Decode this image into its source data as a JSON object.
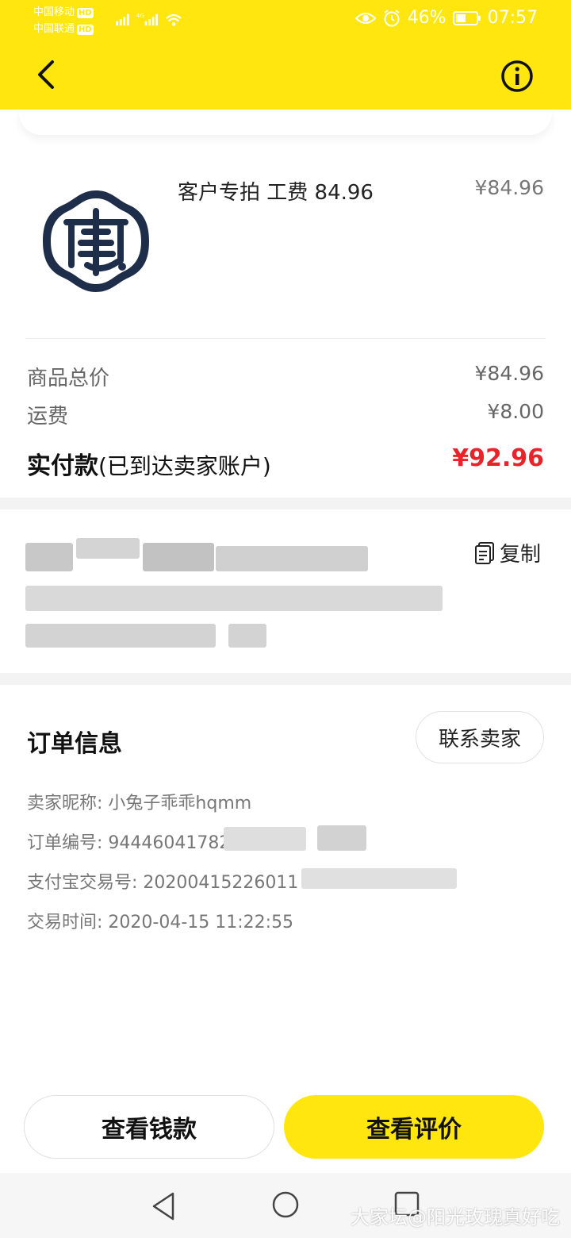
{
  "status_bar": {
    "carrier1": "中国移动",
    "carrier2": "中国联通",
    "hd": "HD",
    "battery": "46%",
    "time": "07:57"
  },
  "product": {
    "title": "客户专拍 工费 84.96",
    "price": "¥84.96",
    "logo_icon": "shop-seal-logo"
  },
  "summary": {
    "goods_total_label": "商品总价",
    "goods_total_value": "¥84.96",
    "shipping_label": "运费",
    "shipping_value": "¥8.00",
    "paid_label": "实付款",
    "paid_note": "(已到达卖家账户)",
    "paid_value": "¥92.96",
    "paid_color": "#e8232a"
  },
  "address": {
    "copy_label": "复制"
  },
  "order_info": {
    "title": "订单信息",
    "contact_seller": "联系卖家",
    "seller_nick": "卖家昵称: 小兔子乖乖hqmm",
    "order_no": "订单编号: 94446041782",
    "alipay_no": "支付宝交易号: 20200415226011",
    "trade_time": "交易时间: 2020-04-15 11:22:55"
  },
  "actions": {
    "view_money": "查看钱款",
    "view_review": "查看评价"
  },
  "watermark": "大家坛@阳光玫瑰真好吃",
  "accent_color": "#ffe60f"
}
